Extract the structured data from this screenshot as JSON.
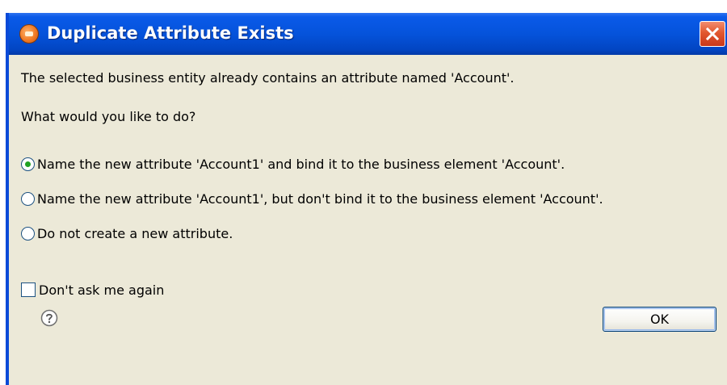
{
  "dialog": {
    "title": "Duplicate Attribute Exists",
    "message": "The selected business entity already contains an attribute named 'Account'.",
    "question": "What would you like to do?",
    "options": [
      {
        "label": "Name the new attribute 'Account1' and bind it to the business element 'Account'.",
        "checked": true
      },
      {
        "label": "Name the new attribute 'Account1', but don't bind it to the business element 'Account'.",
        "checked": false
      },
      {
        "label": "Do not create a new attribute.",
        "checked": false
      }
    ],
    "dont_ask_label": "Don't ask me again",
    "dont_ask_checked": false,
    "ok_label": "OK",
    "icons": {
      "app": "application-icon",
      "close": "close-icon",
      "help": "help-icon"
    },
    "colors": {
      "titlebar": "#0553db",
      "body": "#ece9d8",
      "close": "#e2582f",
      "radio_selected": "#21a121"
    }
  }
}
